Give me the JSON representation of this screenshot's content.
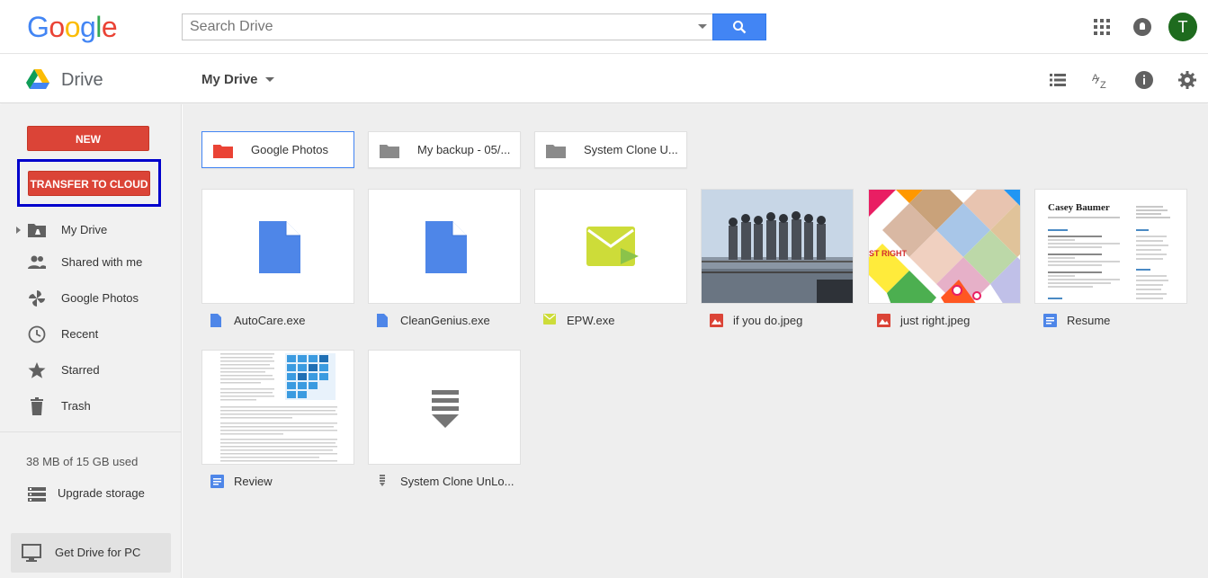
{
  "header": {
    "logo_letters": [
      {
        "ch": "G",
        "color": "#4285f4"
      },
      {
        "ch": "o",
        "color": "#ea4335"
      },
      {
        "ch": "o",
        "color": "#fbbc05"
      },
      {
        "ch": "g",
        "color": "#4285f4"
      },
      {
        "ch": "l",
        "color": "#34a853"
      },
      {
        "ch": "e",
        "color": "#ea4335"
      }
    ],
    "search_placeholder": "Search Drive",
    "avatar_letter": "T"
  },
  "subbar": {
    "app_name": "Drive",
    "location": "My Drive"
  },
  "sidebar": {
    "new_label": "NEW",
    "transfer_label": "TRANSFER TO CLOUD",
    "items": [
      {
        "label": "My Drive",
        "icon": "my-drive-icon"
      },
      {
        "label": "Shared with me",
        "icon": "shared-icon"
      },
      {
        "label": "Google Photos",
        "icon": "photos-icon"
      },
      {
        "label": "Recent",
        "icon": "clock-icon"
      },
      {
        "label": "Starred",
        "icon": "star-icon"
      },
      {
        "label": "Trash",
        "icon": "trash-icon"
      }
    ],
    "storage": "38 MB of 15 GB used",
    "upgrade_label": "Upgrade storage",
    "get_drive_label": "Get Drive for PC"
  },
  "folders": [
    {
      "name": "Google Photos",
      "color": "#ea4335"
    },
    {
      "name": "My backup - 05/...",
      "color": "#8a8a8a"
    },
    {
      "name": "System Clone U...",
      "color": "#8a8a8a"
    }
  ],
  "files": [
    {
      "name": "AutoCare.exe",
      "type": "doc"
    },
    {
      "name": "CleanGenius.exe",
      "type": "doc"
    },
    {
      "name": "EPW.exe",
      "type": "epw"
    },
    {
      "name": "if you do.jpeg",
      "type": "image"
    },
    {
      "name": "just right.jpeg",
      "type": "image"
    },
    {
      "name": "Resume",
      "type": "gdoc"
    },
    {
      "name": "Review",
      "type": "gdoc"
    },
    {
      "name": "System Clone UnLo...",
      "type": "archive"
    }
  ],
  "resume_thumb": {
    "name": "Casey Baumer"
  },
  "thumb_text": {
    "image2": "ST RIGHT"
  },
  "colors": {
    "accent_red": "#db4437",
    "accent_blue": "#4285f4",
    "highlight_box": "#0000cc"
  }
}
